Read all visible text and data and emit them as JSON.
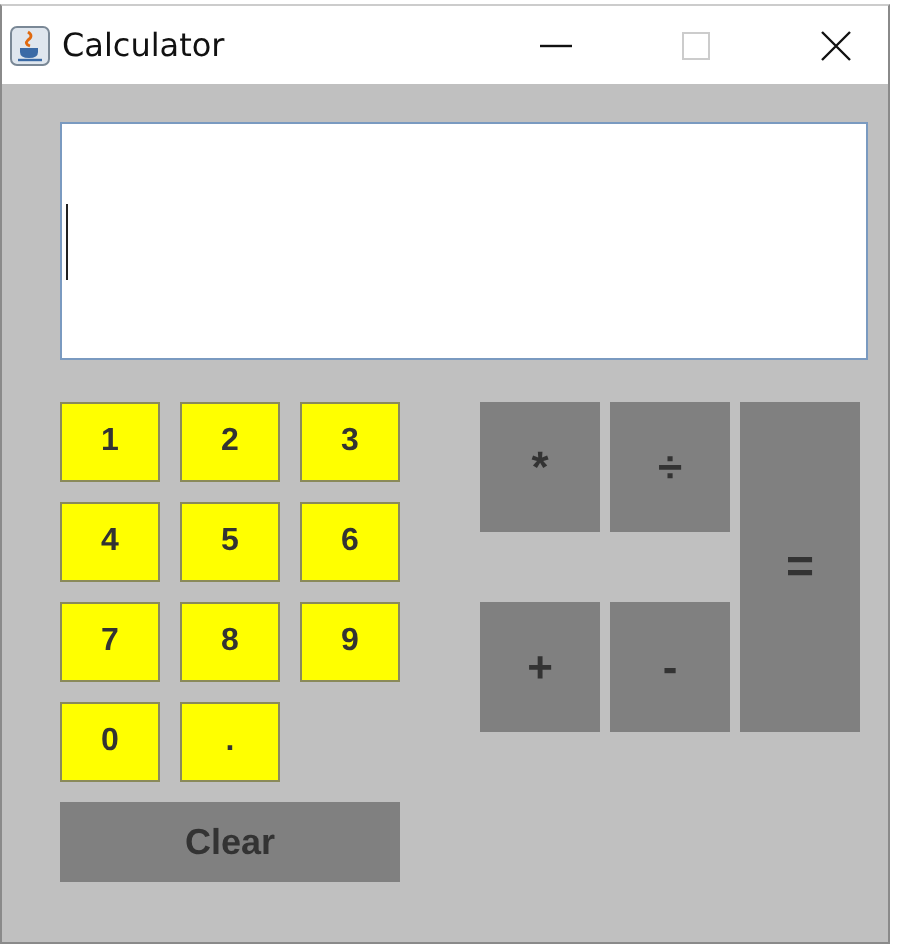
{
  "window": {
    "title": "Calculator"
  },
  "window_controls": [
    {
      "kind": "minimize",
      "disabled": false
    },
    {
      "kind": "maximize",
      "disabled": true
    },
    {
      "kind": "close",
      "disabled": false
    }
  ],
  "display": {
    "focused": true
  },
  "digit_keys": [
    "1",
    "2",
    "3",
    "4",
    "5",
    "6",
    "7",
    "8",
    "9",
    "0",
    "."
  ],
  "operator_keys": [
    "*",
    "÷",
    "+",
    "-"
  ],
  "equals_key": "=",
  "clear_key": "Clear"
}
